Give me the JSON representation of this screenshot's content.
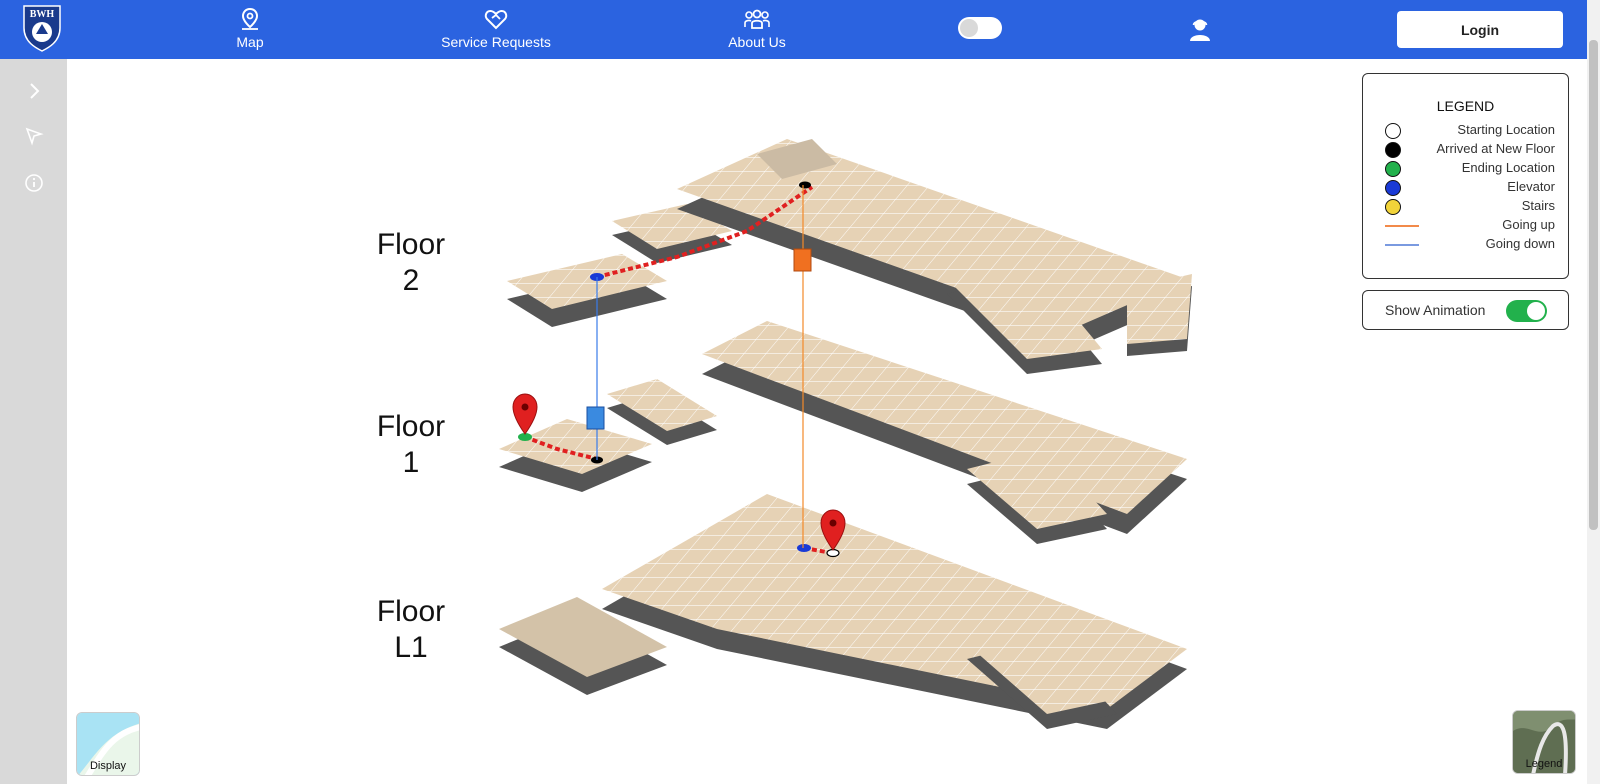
{
  "header": {
    "logo_text": "BWH",
    "nav": [
      {
        "label": "Map",
        "icon": "map-pin-icon"
      },
      {
        "label": "Service Requests",
        "icon": "heart-handshake-icon"
      },
      {
        "label": "About Us",
        "icon": "team-icon"
      }
    ],
    "login_label": "Login",
    "theme_toggle_on": false,
    "brand_color": "#2b63e0"
  },
  "sidebar": {
    "items": [
      {
        "icon": "chevron-right-icon"
      },
      {
        "icon": "cursor-pointer-icon"
      },
      {
        "icon": "info-icon"
      }
    ]
  },
  "map": {
    "floors": [
      {
        "line1": "Floor",
        "line2": "2"
      },
      {
        "line1": "Floor",
        "line2": "1"
      },
      {
        "line1": "Floor",
        "line2": "L1"
      }
    ]
  },
  "legend": {
    "title": "LEGEND",
    "items": [
      {
        "label": "Starting Location",
        "kind": "circle",
        "color": "#ffffff"
      },
      {
        "label": "Arrived at New Floor",
        "kind": "circle",
        "color": "#000000"
      },
      {
        "label": "Ending Location",
        "kind": "circle",
        "color": "#22b14c"
      },
      {
        "label": "Elevator",
        "kind": "circle",
        "color": "#1a3ad6"
      },
      {
        "label": "Stairs",
        "kind": "circle",
        "color": "#f2d43a"
      },
      {
        "label": "Going up",
        "kind": "line",
        "color": "#f28a4a"
      },
      {
        "label": "Going down",
        "kind": "line",
        "color": "#7a9ae0"
      }
    ]
  },
  "animation": {
    "label": "Show Animation",
    "enabled": true
  },
  "corner_buttons": {
    "display_label": "Display",
    "legend_label": "Legend"
  }
}
